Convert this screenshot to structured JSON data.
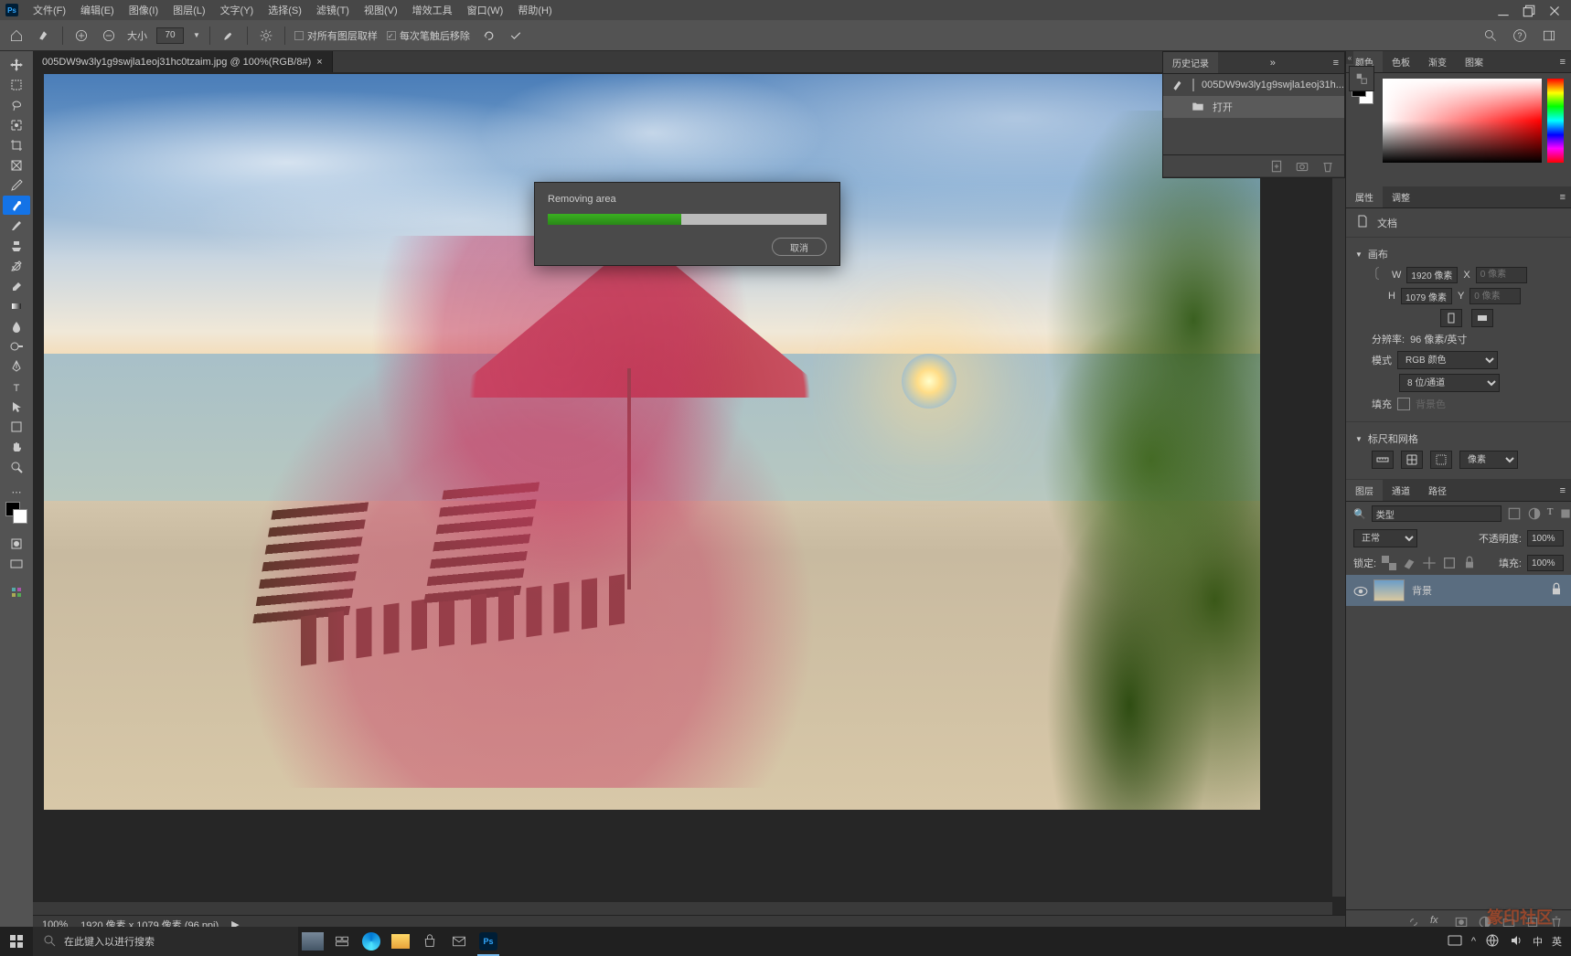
{
  "menubar": [
    "文件(F)",
    "编辑(E)",
    "图像(I)",
    "图层(L)",
    "文字(Y)",
    "选择(S)",
    "滤镜(T)",
    "视图(V)",
    "增效工具",
    "窗口(W)",
    "帮助(H)"
  ],
  "optbar": {
    "size_label": "大小",
    "size_value": "70",
    "chk1": "对所有图层取样",
    "chk2": "每次笔触后移除"
  },
  "tab": {
    "title": "005DW9w3ly1g9swjla1eoj31hc0tzaim.jpg @ 100%(RGB/8#)"
  },
  "dialog": {
    "title": "Removing area",
    "cancel": "取消",
    "progress": 48
  },
  "history": {
    "tab": "历史记录",
    "items": [
      {
        "label": "005DW9w3ly1g9swjla1eoj31h...",
        "thumb": true
      },
      {
        "label": "打开",
        "sel": true
      }
    ]
  },
  "color_tabs": [
    "颜色",
    "色板",
    "渐变",
    "图案"
  ],
  "props": {
    "tabs": [
      "属性",
      "调整"
    ],
    "doc_label": "文档",
    "sec1": "画布",
    "w_label": "W",
    "w_val": "1920 像素",
    "x_label": "X",
    "x_ph": "0 像素",
    "h_label": "H",
    "h_val": "1079 像素",
    "y_label": "Y",
    "y_ph": "0 像素",
    "res_label": "分辨率:",
    "res_val": "96 像素/英寸",
    "mode_label": "模式",
    "mode_val": "RGB 颜色",
    "depth_val": "8 位/通道",
    "fill_label": "填充",
    "fill_ph": "背景色",
    "sec2": "标尺和网格",
    "ruler_unit": "像素"
  },
  "layers": {
    "tabs": [
      "图层",
      "通道",
      "路径"
    ],
    "search": "类型",
    "blend": "正常",
    "opacity_label": "不透明度:",
    "opacity": "100%",
    "lock_label": "锁定:",
    "fill_label": "填充:",
    "fill": "100%",
    "layer_name": "背景"
  },
  "status": {
    "zoom": "100%",
    "dim": "1920 像素 x 1079 像素 (96 ppi)"
  },
  "taskbar": {
    "search_ph": "在此键入以进行搜索",
    "ime": "英",
    "lang": "中"
  },
  "watermark": "篆印社区"
}
